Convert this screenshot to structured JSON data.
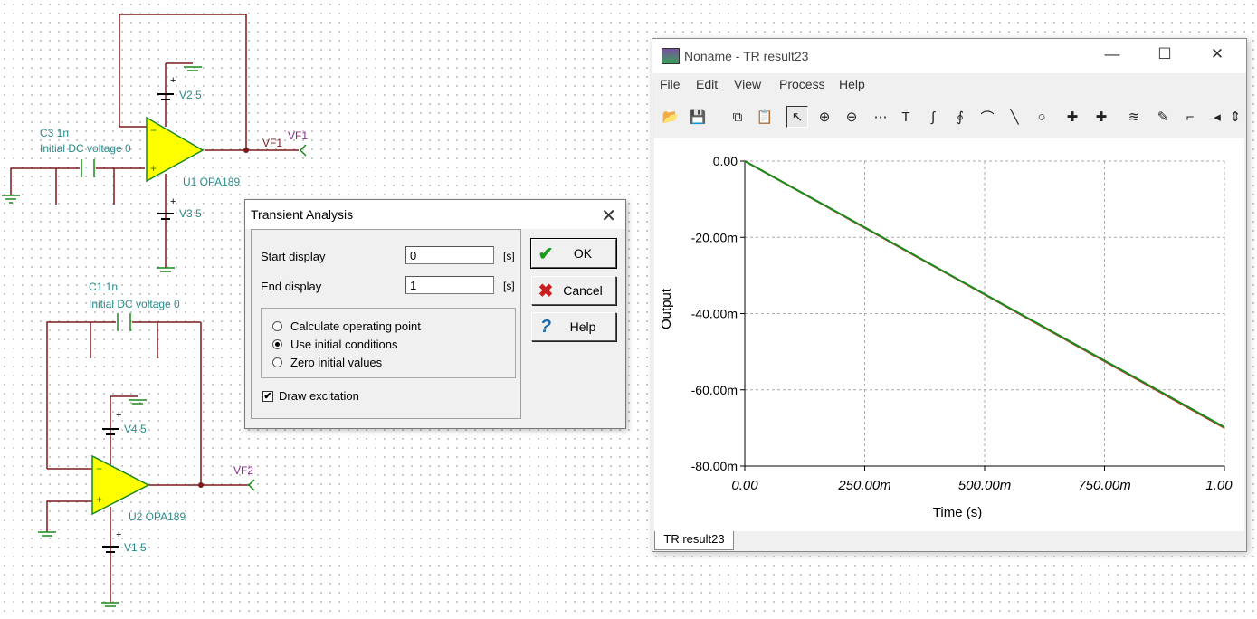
{
  "schematic": {
    "components": [
      {
        "ref": "C3 1n",
        "note": "Initial DC voltage 0"
      },
      {
        "ref": "V2 5"
      },
      {
        "ref": "U1 OPA189"
      },
      {
        "ref": "V3 5"
      },
      {
        "ref": "VF1"
      },
      {
        "ref": "C1 1n",
        "note": "Initial DC voltage 0"
      },
      {
        "ref": "V4 5"
      },
      {
        "ref": "U2 OPA189"
      },
      {
        "ref": "V1 5"
      },
      {
        "ref": "VF2"
      }
    ],
    "wire_label_vf1": "VF1",
    "colors": {
      "wire": "#7a1a1a",
      "opamp_fill": "#ffff00",
      "component": "#1a8a1a",
      "label": "#2a8a8a",
      "probe": "#8a2a8a"
    }
  },
  "dialog": {
    "title": "Transient Analysis",
    "close_icon": "close-icon",
    "start_label": "Start display",
    "start_value": "0",
    "start_unit": "[s]",
    "end_label": "End display",
    "end_value": "1",
    "end_unit": "[s]",
    "options": [
      {
        "label": "Calculate operating point",
        "selected": false
      },
      {
        "label": "Use initial conditions",
        "selected": true
      },
      {
        "label": "Zero initial values",
        "selected": false
      }
    ],
    "draw_excitation_label": "Draw excitation",
    "draw_excitation_checked": true,
    "checkmark": "✔",
    "ok_label": "OK",
    "cancel_label": "Cancel",
    "help_label": "Help",
    "ok_icon": "✔",
    "cancel_icon": "✖",
    "help_icon": "?"
  },
  "window": {
    "title": "Noname - TR result23",
    "minimize": "—",
    "maximize": "☐",
    "close": "✕",
    "menu": [
      "File",
      "Edit",
      "View",
      "Process",
      "Help"
    ],
    "toolbar": [
      {
        "name": "open-icon",
        "glyph": "📂"
      },
      {
        "name": "save-icon",
        "glyph": "💾"
      },
      {
        "name": "copy-icon",
        "glyph": "⧉"
      },
      {
        "name": "paste-icon",
        "glyph": "📋"
      },
      {
        "name": "pointer-icon",
        "glyph": "↖"
      },
      {
        "name": "zoom-in-icon",
        "glyph": "⊕"
      },
      {
        "name": "zoom-100-icon",
        "glyph": "⊖"
      },
      {
        "name": "grid-icon",
        "glyph": "⋯"
      },
      {
        "name": "text-icon",
        "glyph": "T"
      },
      {
        "name": "cursor-a-icon",
        "glyph": "∫"
      },
      {
        "name": "cursor-b-icon",
        "glyph": "∮"
      },
      {
        "name": "curve-icon",
        "glyph": "⌒"
      },
      {
        "name": "line-icon",
        "glyph": "╲"
      },
      {
        "name": "circle-icon",
        "glyph": "○"
      },
      {
        "name": "marker-a-icon",
        "glyph": "✚"
      },
      {
        "name": "marker-b-icon",
        "glyph": "✚"
      },
      {
        "name": "curves-icon",
        "glyph": "≋"
      },
      {
        "name": "probe-icon",
        "glyph": "✎"
      },
      {
        "name": "step-icon",
        "glyph": "⌐"
      },
      {
        "name": "scroll-left-icon",
        "glyph": "◂"
      },
      {
        "name": "scroll-updown-icon",
        "glyph": "⇕"
      }
    ],
    "tab_label": "TR result23"
  },
  "chart_data": {
    "type": "line",
    "xlabel": "Time (s)",
    "ylabel": "Output",
    "xlim": [
      0,
      1
    ],
    "ylim": [
      -0.08,
      0
    ],
    "x_ticks": [
      "0.00",
      "250.00m",
      "500.00m",
      "750.00m",
      "1.00"
    ],
    "y_ticks": [
      "0.00",
      "-20.00m",
      "-40.00m",
      "-60.00m",
      "-80.00m"
    ],
    "grid": true,
    "series": [
      {
        "color": "#c83030",
        "x": [
          0,
          0.25,
          0.5,
          0.75,
          1.0
        ],
        "values": [
          0,
          -0.0175,
          -0.035,
          -0.0525,
          -0.07
        ]
      },
      {
        "color": "#1a8a1a",
        "x": [
          0,
          0.25,
          0.5,
          0.75,
          1.0
        ],
        "values": [
          0,
          -0.0174,
          -0.0349,
          -0.0523,
          -0.0698
        ]
      }
    ]
  }
}
